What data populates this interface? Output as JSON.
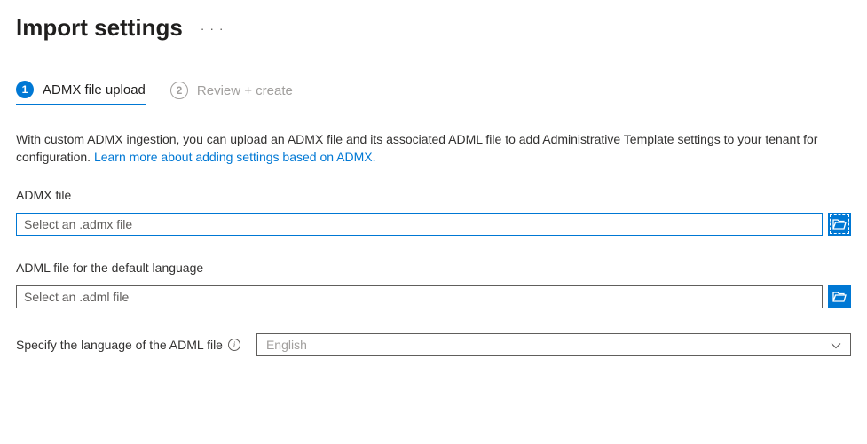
{
  "header": {
    "title": "Import settings"
  },
  "tabs": [
    {
      "num": "1",
      "label": "ADMX file upload"
    },
    {
      "num": "2",
      "label": "Review + create"
    }
  ],
  "description": {
    "text": "With custom ADMX ingestion, you can upload an ADMX file and its associated ADML file to add Administrative Template settings to your tenant for configuration. ",
    "link": "Learn more about adding settings based on ADMX."
  },
  "admx": {
    "label": "ADMX file",
    "placeholder": "Select an .admx file"
  },
  "adml": {
    "label": "ADML file for the default language",
    "placeholder": "Select an .adml file"
  },
  "lang": {
    "label": "Specify the language of the ADML file",
    "value": "English"
  }
}
